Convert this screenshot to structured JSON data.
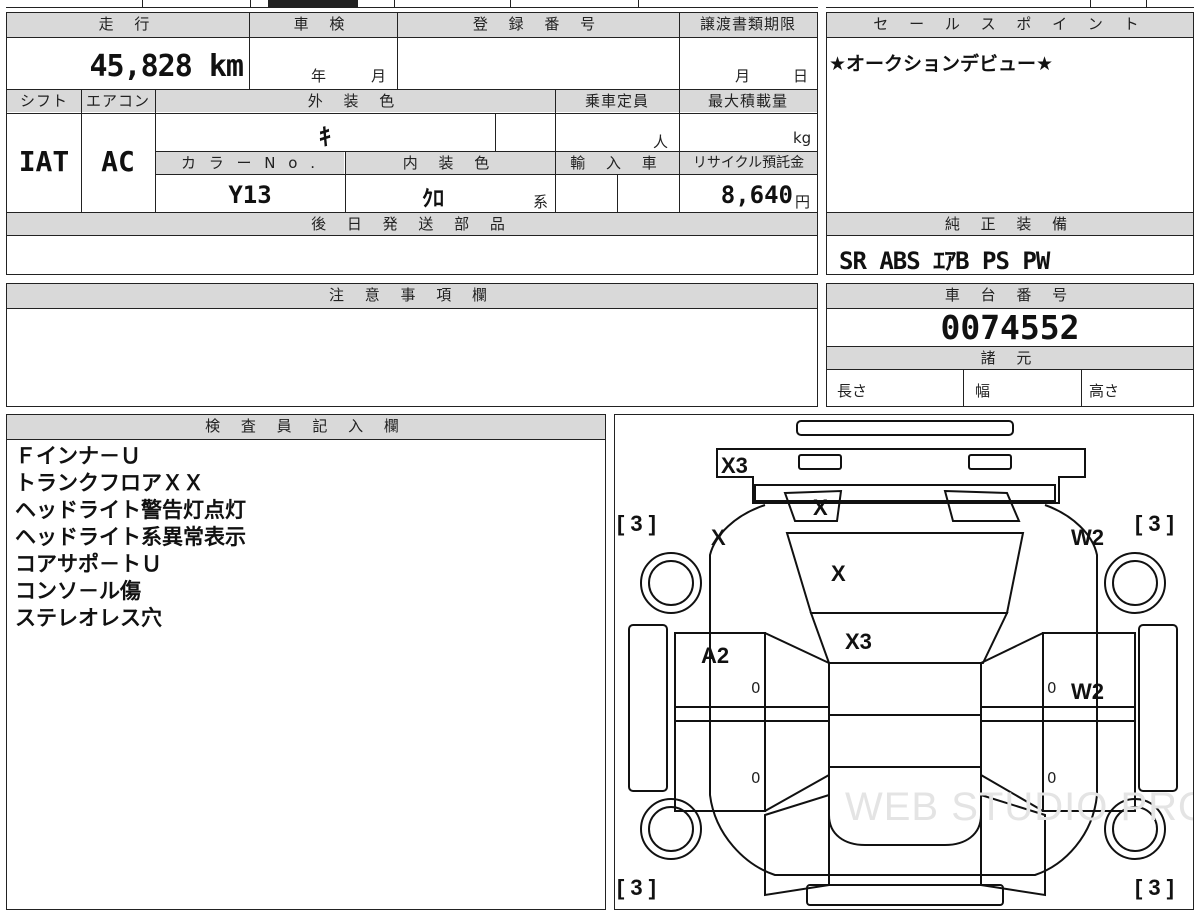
{
  "top": {
    "mileage_label": "走 行",
    "mileage_value": "45,828 km",
    "inspection_label": "車 検",
    "inspection_year_unit": "年",
    "inspection_month_unit": "月",
    "reg_number_label": "登 録 番 号",
    "transfer_deadline_label": "譲渡書類期限",
    "transfer_month_unit": "月",
    "transfer_day_unit": "日",
    "shift_label": "シフト",
    "shift_value": "IAT",
    "ac_label": "エアコン",
    "ac_value": "AC",
    "exterior_color_label": "外 装 色",
    "exterior_color_value": "ｷ",
    "capacity_label": "乗車定員",
    "capacity_unit": "人",
    "max_load_label": "最大積載量",
    "max_load_unit": "kg",
    "color_no_label": "カ ラ ー N o .",
    "color_no_value": "Y13",
    "interior_color_label": "内 装 色",
    "interior_color_value": "ｸﾛ",
    "interior_color_suffix": "系",
    "import_label": "輸 入 車",
    "recycle_label": "リサイクル預託金",
    "recycle_value": "8,640",
    "recycle_unit": "円",
    "later_parts_label": "後 日 発 送 部 品"
  },
  "sales": {
    "header": "セ ー ル ス ポ イ ン ト",
    "text": "★オークションデビュー★"
  },
  "equipment": {
    "header": "純 正 装 備",
    "value": "SR ABS ｴｱB PS PW"
  },
  "notes": {
    "header": "注 意 事 項 欄"
  },
  "chassis": {
    "header": "車 台 番 号",
    "value": "0074552"
  },
  "specs": {
    "header": "諸 元",
    "length_label": "長さ",
    "width_label": "幅",
    "height_label": "高さ"
  },
  "inspector": {
    "header": "検 査 員 記 入 欄",
    "lines": [
      "Ｆインナ－Ｕ",
      "トランクフロアＸＸ",
      "ヘッドライト警告灯点灯",
      "ヘッドライト系異常表示",
      "コアサポ－トＵ",
      "コンソ－ル傷",
      "ステレオレス穴"
    ]
  },
  "diagram": {
    "rear_bumper": "X3",
    "trunk": "X",
    "rear_left_quarter": "X",
    "rear_glass": "X",
    "rear_right_quarter": "W2",
    "roof": "X3",
    "left_rear_door": "A2",
    "right_rear_door": "W2",
    "tire_tl": "3",
    "tire_tr": "3",
    "tire_bl": "3",
    "tire_br": "3",
    "door_mark_1": "0",
    "door_mark_2": "0",
    "door_mark_3": "0",
    "door_mark_4": "0",
    "watermark": "WEB STUDIO PRO"
  }
}
